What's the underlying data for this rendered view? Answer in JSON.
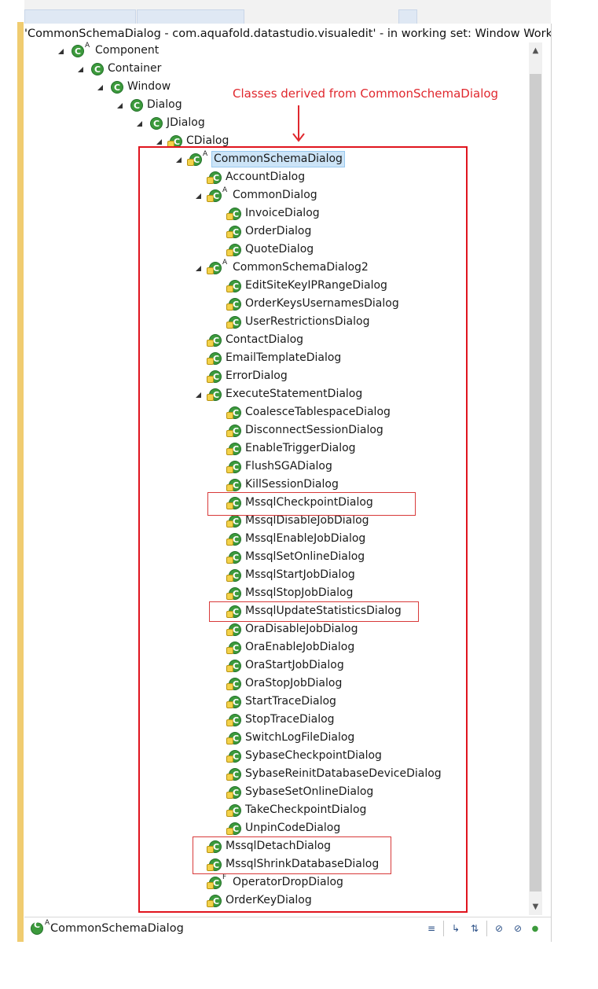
{
  "window": {
    "title": "'CommonSchemaDialog - com.aquafold.datastudio.visualedit' - in working set: Window Working Se"
  },
  "annotation": {
    "text": "Classes derived from CommonSchemaDialog",
    "color": "#e0282e"
  },
  "tree": {
    "rows": [
      {
        "label": "Component",
        "indent": 0,
        "expanded": true,
        "icon": "class-icon",
        "modifier": "A"
      },
      {
        "label": "Container",
        "indent": 1,
        "expanded": true,
        "icon": "class-icon",
        "modifier": ""
      },
      {
        "label": "Window",
        "indent": 2,
        "expanded": true,
        "icon": "class-icon",
        "modifier": ""
      },
      {
        "label": "Dialog",
        "indent": 3,
        "expanded": true,
        "icon": "class-icon",
        "modifier": ""
      },
      {
        "label": "JDialog",
        "indent": 4,
        "expanded": true,
        "icon": "class-icon",
        "modifier": ""
      },
      {
        "label": "CDialog",
        "indent": 5,
        "expanded": true,
        "icon": "package-class-icon",
        "modifier": ""
      },
      {
        "label": "CommonSchemaDialog",
        "indent": 6,
        "expanded": true,
        "icon": "package-class-icon",
        "modifier": "A",
        "selected": true
      },
      {
        "label": "AccountDialog",
        "indent": 7,
        "expanded": false,
        "icon": "package-class-icon",
        "modifier": ""
      },
      {
        "label": "CommonDialog",
        "indent": 7,
        "expanded": true,
        "icon": "package-class-icon",
        "modifier": "A"
      },
      {
        "label": "InvoiceDialog",
        "indent": 8,
        "expanded": false,
        "icon": "package-class-icon",
        "modifier": ""
      },
      {
        "label": "OrderDialog",
        "indent": 8,
        "expanded": false,
        "icon": "package-class-icon",
        "modifier": ""
      },
      {
        "label": "QuoteDialog",
        "indent": 8,
        "expanded": false,
        "icon": "package-class-icon",
        "modifier": ""
      },
      {
        "label": "CommonSchemaDialog2",
        "indent": 7,
        "expanded": true,
        "icon": "package-class-icon",
        "modifier": "A"
      },
      {
        "label": "EditSiteKeyIPRangeDialog",
        "indent": 8,
        "expanded": false,
        "icon": "package-class-icon",
        "modifier": ""
      },
      {
        "label": "OrderKeysUsernamesDialog",
        "indent": 8,
        "expanded": false,
        "icon": "package-class-icon",
        "modifier": ""
      },
      {
        "label": "UserRestrictionsDialog",
        "indent": 8,
        "expanded": false,
        "icon": "package-class-icon",
        "modifier": ""
      },
      {
        "label": "ContactDialog",
        "indent": 7,
        "expanded": false,
        "icon": "package-class-icon",
        "modifier": ""
      },
      {
        "label": "EmailTemplateDialog",
        "indent": 7,
        "expanded": false,
        "icon": "package-class-icon",
        "modifier": ""
      },
      {
        "label": "ErrorDialog",
        "indent": 7,
        "expanded": false,
        "icon": "package-class-icon",
        "modifier": ""
      },
      {
        "label": "ExecuteStatementDialog",
        "indent": 7,
        "expanded": true,
        "icon": "package-class-icon",
        "modifier": ""
      },
      {
        "label": "CoalesceTablespaceDialog",
        "indent": 8,
        "expanded": false,
        "icon": "package-class-icon",
        "modifier": ""
      },
      {
        "label": "DisconnectSessionDialog",
        "indent": 8,
        "expanded": false,
        "icon": "package-class-icon",
        "modifier": ""
      },
      {
        "label": "EnableTriggerDialog",
        "indent": 8,
        "expanded": false,
        "icon": "package-class-icon",
        "modifier": ""
      },
      {
        "label": "FlushSGADialog",
        "indent": 8,
        "expanded": false,
        "icon": "package-class-icon",
        "modifier": ""
      },
      {
        "label": "KillSessionDialog",
        "indent": 8,
        "expanded": false,
        "icon": "package-class-icon",
        "modifier": ""
      },
      {
        "label": "MssqlCheckpointDialog",
        "indent": 8,
        "expanded": false,
        "icon": "package-class-icon",
        "modifier": ""
      },
      {
        "label": "MssqlDisableJobDialog",
        "indent": 8,
        "expanded": false,
        "icon": "package-class-icon",
        "modifier": ""
      },
      {
        "label": "MssqlEnableJobDialog",
        "indent": 8,
        "expanded": false,
        "icon": "package-class-icon",
        "modifier": ""
      },
      {
        "label": "MssqlSetOnlineDialog",
        "indent": 8,
        "expanded": false,
        "icon": "package-class-icon",
        "modifier": ""
      },
      {
        "label": "MssqlStartJobDialog",
        "indent": 8,
        "expanded": false,
        "icon": "package-class-icon",
        "modifier": ""
      },
      {
        "label": "MssqlStopJobDialog",
        "indent": 8,
        "expanded": false,
        "icon": "package-class-icon",
        "modifier": ""
      },
      {
        "label": "MssqlUpdateStatisticsDialog",
        "indent": 8,
        "expanded": false,
        "icon": "package-class-icon",
        "modifier": ""
      },
      {
        "label": "OraDisableJobDialog",
        "indent": 8,
        "expanded": false,
        "icon": "package-class-icon",
        "modifier": ""
      },
      {
        "label": "OraEnableJobDialog",
        "indent": 8,
        "expanded": false,
        "icon": "package-class-icon",
        "modifier": ""
      },
      {
        "label": "OraStartJobDialog",
        "indent": 8,
        "expanded": false,
        "icon": "package-class-icon",
        "modifier": ""
      },
      {
        "label": "OraStopJobDialog",
        "indent": 8,
        "expanded": false,
        "icon": "package-class-icon",
        "modifier": ""
      },
      {
        "label": "StartTraceDialog",
        "indent": 8,
        "expanded": false,
        "icon": "package-class-icon",
        "modifier": ""
      },
      {
        "label": "StopTraceDialog",
        "indent": 8,
        "expanded": false,
        "icon": "package-class-icon",
        "modifier": ""
      },
      {
        "label": "SwitchLogFileDialog",
        "indent": 8,
        "expanded": false,
        "icon": "package-class-icon",
        "modifier": ""
      },
      {
        "label": "SybaseCheckpointDialog",
        "indent": 8,
        "expanded": false,
        "icon": "package-class-icon",
        "modifier": ""
      },
      {
        "label": "SybaseReinitDatabaseDeviceDialog",
        "indent": 8,
        "expanded": false,
        "icon": "package-class-icon",
        "modifier": ""
      },
      {
        "label": "SybaseSetOnlineDialog",
        "indent": 8,
        "expanded": false,
        "icon": "package-class-icon",
        "modifier": ""
      },
      {
        "label": "TakeCheckpointDialog",
        "indent": 8,
        "expanded": false,
        "icon": "package-class-icon",
        "modifier": ""
      },
      {
        "label": "UnpinCodeDialog",
        "indent": 8,
        "expanded": false,
        "icon": "package-class-icon",
        "modifier": ""
      },
      {
        "label": "MssqlDetachDialog",
        "indent": 7,
        "expanded": false,
        "icon": "package-class-icon",
        "modifier": ""
      },
      {
        "label": "MssqlShrinkDatabaseDialog",
        "indent": 7,
        "expanded": false,
        "icon": "package-class-icon",
        "modifier": ""
      },
      {
        "label": "OperatorDropDialog",
        "indent": 7,
        "expanded": false,
        "icon": "package-class-icon",
        "modifier": "F"
      },
      {
        "label": "OrderKeyDialog",
        "indent": 7,
        "expanded": false,
        "icon": "package-class-icon",
        "modifier": ""
      }
    ]
  },
  "statusbar": {
    "text": "CommonSchemaDialog",
    "modifier": "A",
    "tools": [
      "show-qualified-names-icon",
      "lock-view-icon",
      "sort-hierarchy-icon",
      "hide-fields-icon",
      "hide-static-icon",
      "hide-nonpublic-icon"
    ]
  },
  "colors": {
    "highlight_box": "#e0141e",
    "selection": "#cce4f7",
    "class_icon": "#3c9a3c",
    "left_bar": "#f0cc70"
  }
}
